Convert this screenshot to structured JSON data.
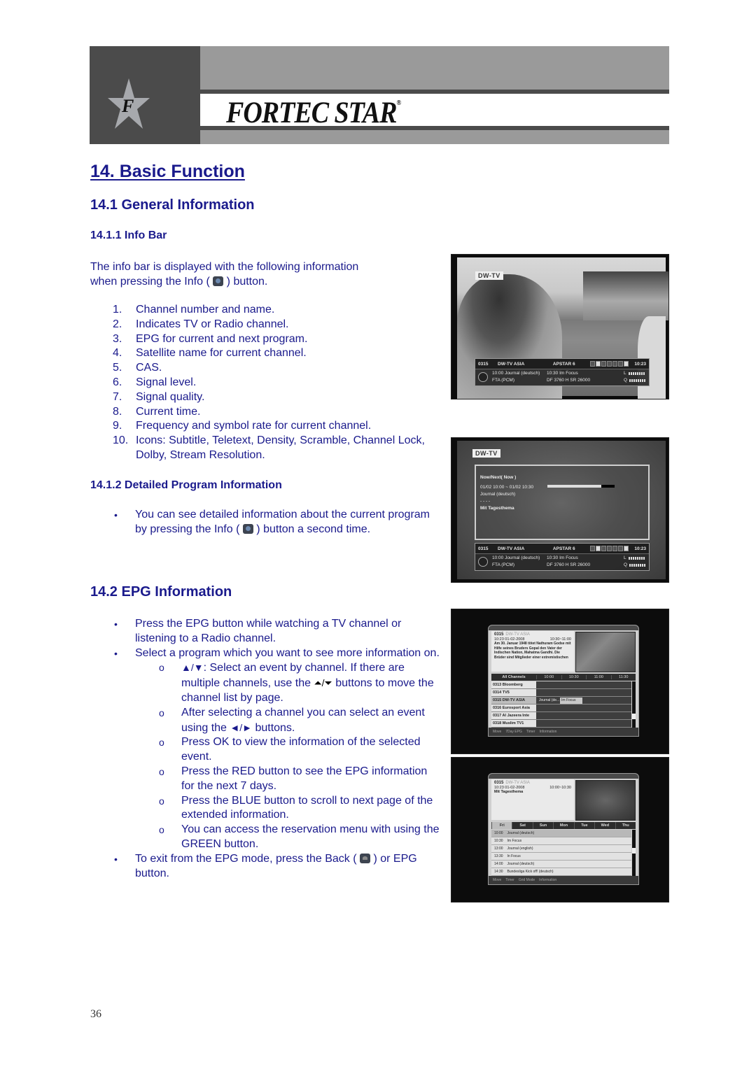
{
  "header": {
    "brand": "FORTEC STAR",
    "brand_mark": "®",
    "logo_letter": "F"
  },
  "section_14": {
    "title": "14.  Basic Function"
  },
  "section_14_1": {
    "title": "14.1 General Information",
    "info_bar": {
      "title": "14.1.1 Info Bar",
      "intro_before": "The info bar is displayed with the following information",
      "intro_line2_before": "when pressing the Info ( ",
      "intro_line2_after": " ) button.",
      "items": [
        {
          "num": "1.",
          "text": "Channel number and name."
        },
        {
          "num": "2.",
          "text": "Indicates TV or Radio channel."
        },
        {
          "num": "3.",
          "text": "EPG for current and next program."
        },
        {
          "num": "4.",
          "text": "Satellite name for current channel."
        },
        {
          "num": "5.",
          "text": "CAS."
        },
        {
          "num": "6.",
          "text": "Signal level."
        },
        {
          "num": "7.",
          "text": "Signal quality."
        },
        {
          "num": "8.",
          "text": "Current time."
        },
        {
          "num": "9.",
          "text": "Frequency and symbol rate for current channel."
        },
        {
          "num": "10.",
          "text": "Icons: Subtitle, Teletext, Density, Scramble, Channel Lock, Dolby, Stream Resolution."
        }
      ]
    },
    "detailed": {
      "title": "14.1.2 Detailed Program Information",
      "bullet_before": "You can see detailed information about the current program by pressing the Info ( ",
      "bullet_after": " ) button a second time."
    }
  },
  "section_14_2": {
    "title": "14.2 EPG Information",
    "bullets": [
      {
        "text": "Press the EPG button while watching a TV channel or listening to a Radio channel."
      },
      {
        "text": "Select a program which you want to see more information on."
      }
    ],
    "sub_items": [
      {
        "glyph": "▲/▼",
        "text": ": Select an event by channel. If there are multiple channels, use the ",
        "glyph2": "⏶/⏷",
        "text2": " buttons to move the channel list by page."
      },
      {
        "text": "After selecting a channel you can select an event using the ",
        "glyph": "◄/►",
        "text2": " buttons."
      },
      {
        "text": "Press OK to view the information of the selected event."
      },
      {
        "text": "Press the RED button to see the EPG information for the next 7 days."
      },
      {
        "text": "Press the BLUE button to scroll to next page of the extended information."
      },
      {
        "text": "You can access the reservation menu with using the GREEN button."
      }
    ],
    "exit_before": "To exit from the EPG mode, press the Back ( ",
    "exit_after": " ) or EPG button.",
    "bullet_glyph": "•",
    "sub_glyph": "o"
  },
  "screens": {
    "logo": "DW-TV",
    "infobar": {
      "channel_num": "0315",
      "channel_name": "DW-TV ASIA",
      "satellite": "APSTAR 6",
      "time": "10:23",
      "now": "10:00 Journal (deutsch)",
      "next": "10:30 Im Focus",
      "cas": "FTA (PCM)",
      "freq": "DF 3760 H SR 26000",
      "level_label": "L",
      "quality_label": "Q"
    },
    "detail": {
      "heading": "Now/Next( Now )",
      "range": "01/02 10:00 ~ 01/02 10:30",
      "title": "Journal (deutsch)",
      "dots": "- - - -",
      "desc": "Mit Tagesthema",
      "progress": 0.8
    },
    "epg_grid": {
      "channel_num": "0315",
      "channel_name": "DW-TV ASIA",
      "date": "10:23 01-02-2008",
      "slot_time": "10:30~11:00",
      "description": "Am 30. Januar 1948 tötet Nathuram Godse mit Hilfe seines Bruders Gopal den Vater der Indischen Nation, Mahatma Gandhi. Die Brüder sind Mitglieder einer extremistischen",
      "all_channels": "All Channels",
      "slots": [
        "10:00",
        "10:30",
        "11:00",
        "11:30"
      ],
      "channels": [
        {
          "name": "0313 Bloomberg"
        },
        {
          "name": "0314 TV5"
        },
        {
          "name": "0315 DW-TV ASIA",
          "selected": true,
          "events": [
            "Journal (de...",
            "Im Focus"
          ]
        },
        {
          "name": "0316 Eurosport Asia"
        },
        {
          "name": "0317 Al Jazeera Inte"
        },
        {
          "name": "0318 Muslim TV1"
        }
      ],
      "footer": [
        "Move",
        "7Day EPG",
        "Timer",
        "Information"
      ]
    },
    "epg_week": {
      "channel_num": "0315",
      "channel_name": "DW-TV ASIA",
      "date": "10:23 01-02-2008",
      "slot_time": "10:00~10:30",
      "description": "Mit Tagesthema",
      "days": [
        "Fri",
        "Sat",
        "Sun",
        "Mon",
        "Tue",
        "Wed",
        "Thu"
      ],
      "selected_day": "Fri",
      "events": [
        {
          "time": "10:00",
          "title": "Journal (deutsch)",
          "selected": true
        },
        {
          "time": "10:30",
          "title": "Im Focus"
        },
        {
          "time": "13:00",
          "title": "Journal (english)"
        },
        {
          "time": "13:30",
          "title": "In Focus"
        },
        {
          "time": "14:00",
          "title": "Journal (deutsch)"
        },
        {
          "time": "14:30",
          "title": "Bundesliga Kick off! (deutsch)"
        }
      ],
      "footer": [
        "Move",
        "Timer",
        "Grid Mode",
        "Information"
      ]
    }
  },
  "footer": {
    "page_number": "36"
  },
  "colors": {
    "text": "#1a1a8c",
    "banner_dark": "#4b4b4b",
    "banner_light": "#9a9a9a"
  }
}
